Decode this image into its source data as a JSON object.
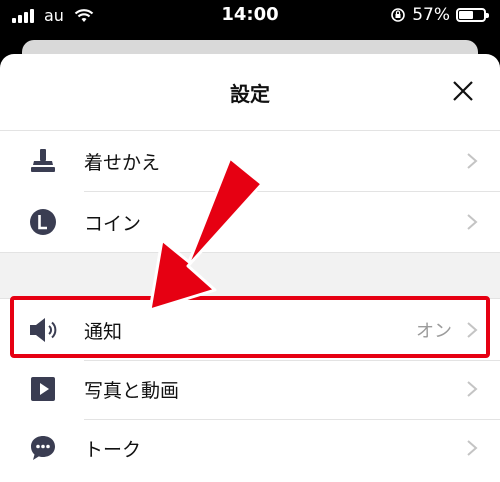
{
  "status_bar": {
    "carrier": "au",
    "time": "14:00",
    "battery": "57%",
    "battery_level": 0.57
  },
  "sheet": {
    "title": "設定",
    "close_icon": "close-icon"
  },
  "settings": {
    "items": [
      {
        "label": "着せかえ",
        "icon": "theme-brush-icon",
        "value": ""
      },
      {
        "label": "コイン",
        "icon": "coin-icon",
        "value": ""
      },
      {
        "label": "通知",
        "icon": "speaker-icon",
        "value": "オン"
      },
      {
        "label": "写真と動画",
        "icon": "play-icon",
        "value": ""
      },
      {
        "label": "トーク",
        "icon": "chat-bubble-icon",
        "value": ""
      }
    ]
  },
  "annotation": {
    "highlight_color": "#e60012",
    "arrow_color": "#e60012"
  },
  "colors": {
    "icon": "#3a3d52",
    "chevron": "#c4c4c4",
    "value_text": "#9b9b9b"
  }
}
